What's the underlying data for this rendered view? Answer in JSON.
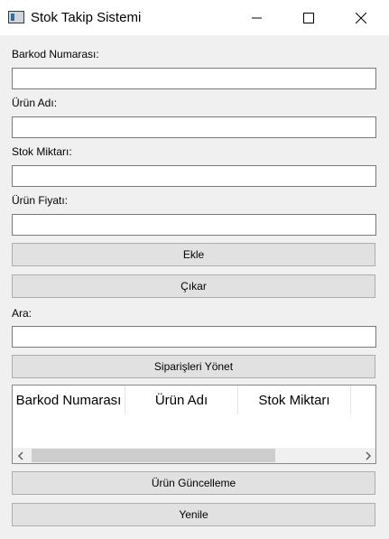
{
  "window": {
    "title": "Stok Takip Sistemi",
    "icon": "app-window-icon",
    "controls": [
      "minimize-icon",
      "maximize-icon",
      "close-icon"
    ]
  },
  "form": {
    "barcode_label": "Barkod Numarası:",
    "barcode_value": "",
    "name_label": "Ürün Adı:",
    "name_value": "",
    "stock_label": "Stok Miktarı:",
    "stock_value": "",
    "price_label": "Ürün Fiyatı:",
    "price_value": ""
  },
  "buttons": {
    "add": "Ekle",
    "remove": "Çıkar",
    "orders": "Siparişleri Yönet",
    "update": "Ürün Güncelleme",
    "refresh": "Yenile"
  },
  "search": {
    "label": "Ara:",
    "value": ""
  },
  "table": {
    "columns": [
      "Barkod Numarası",
      "Ürün Adı",
      "Stok Miktarı"
    ],
    "rows": []
  },
  "colors": {
    "window_bg": "#f0f0f0",
    "titlebar_bg": "#ffffff",
    "button_bg": "#e1e1e1",
    "button_border": "#adadad",
    "field_border": "#7a7a7a"
  }
}
